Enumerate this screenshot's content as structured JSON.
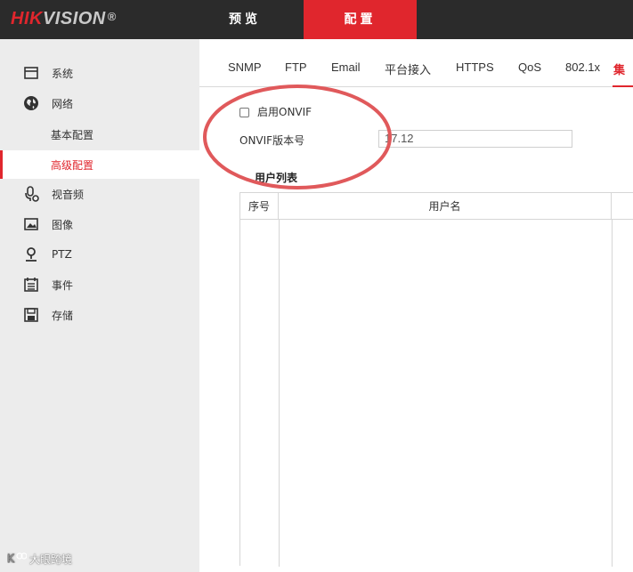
{
  "header": {
    "logo_hik": "HIK",
    "logo_vision": "VISION",
    "logo_reg": "®",
    "nav": {
      "preview": "预览",
      "config": "配置"
    },
    "accent_color": "#e0262d"
  },
  "sidebar": {
    "items": [
      {
        "label": "系统",
        "icon": "monitor-icon"
      },
      {
        "label": "网络",
        "icon": "globe-icon"
      },
      {
        "label": "基本配置"
      },
      {
        "label": "高级配置",
        "active": true
      },
      {
        "label": "视音频",
        "icon": "microphone-icon"
      },
      {
        "label": "图像",
        "icon": "image-icon"
      },
      {
        "label": "PTZ",
        "icon": "ptz-icon"
      },
      {
        "label": "事件",
        "icon": "calendar-icon"
      },
      {
        "label": "存储",
        "icon": "save-icon"
      }
    ],
    "watermark": "大眼跨境"
  },
  "subtabs": [
    "SNMP",
    "FTP",
    "Email",
    "平台接入",
    "HTTPS",
    "QoS",
    "802.1x",
    "集"
  ],
  "onvif": {
    "enable_label": "启用ONVIF",
    "enable_checked": false,
    "version_label": "ONVIF版本号",
    "version_value": "17.12"
  },
  "user_list": {
    "title": "用户列表",
    "columns": [
      "序号",
      "用户名"
    ],
    "rows": []
  }
}
